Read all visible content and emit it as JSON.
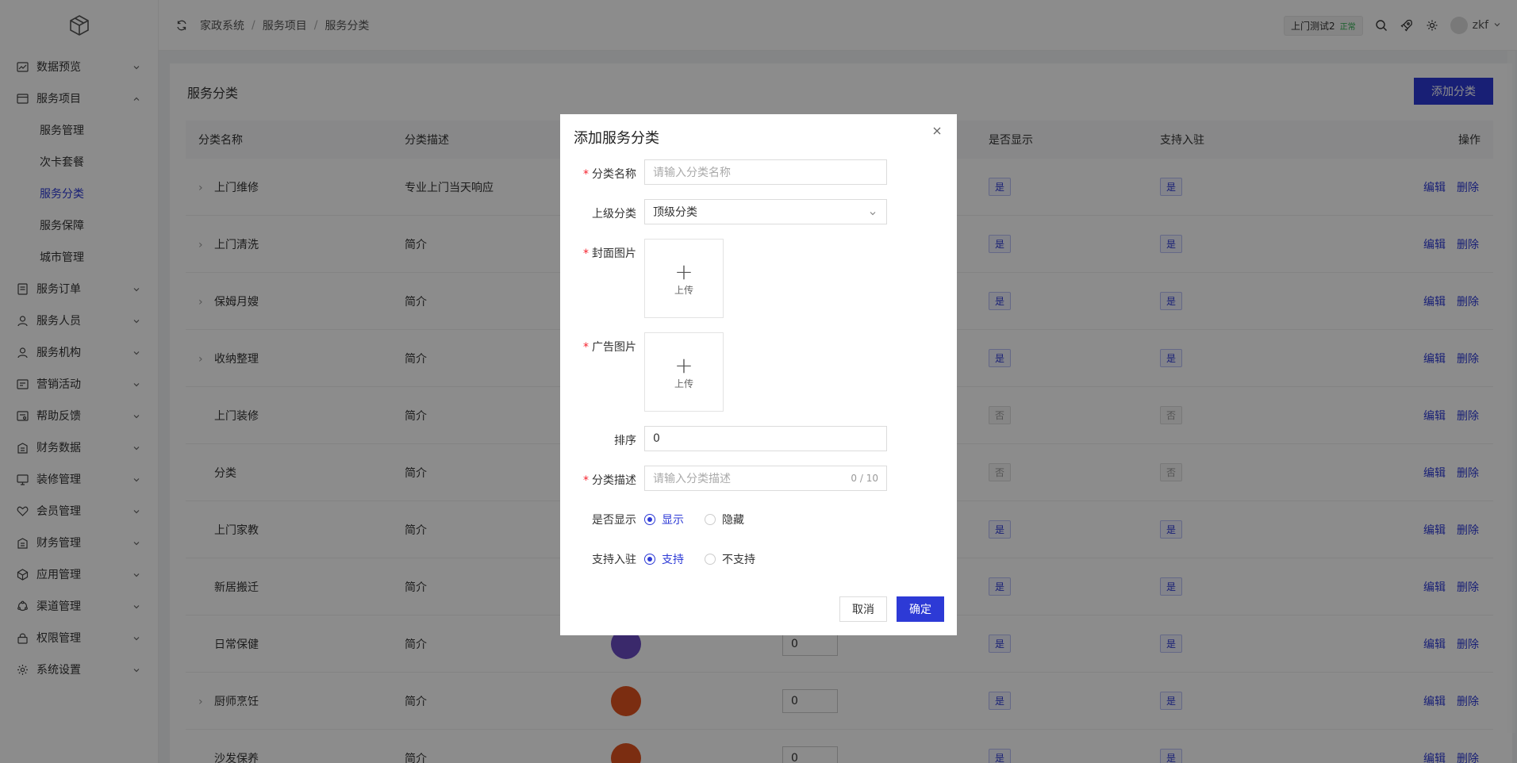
{
  "sidebar": {
    "items": [
      {
        "label": "数据预览"
      },
      {
        "label": "服务项目"
      },
      {
        "label": "服务订单"
      },
      {
        "label": "服务人员"
      },
      {
        "label": "服务机构"
      },
      {
        "label": "营销活动"
      },
      {
        "label": "帮助反馈"
      },
      {
        "label": "财务数据"
      },
      {
        "label": "装修管理"
      },
      {
        "label": "会员管理"
      },
      {
        "label": "财务管理"
      },
      {
        "label": "应用管理"
      },
      {
        "label": "渠道管理"
      },
      {
        "label": "权限管理"
      },
      {
        "label": "系统设置"
      }
    ],
    "sub_items": [
      {
        "label": "服务管理"
      },
      {
        "label": "次卡套餐"
      },
      {
        "label": "服务分类"
      },
      {
        "label": "服务保障"
      },
      {
        "label": "城市管理"
      }
    ]
  },
  "header": {
    "breadcrumb": [
      "家政系统",
      "服务项目",
      "服务分类"
    ],
    "store_name": "上门测试2",
    "store_status": "正常",
    "username": "zkf"
  },
  "main": {
    "title": "服务分类",
    "add_button": "添加分类",
    "columns": [
      "分类名称",
      "分类描述",
      "是否显示",
      "支持入驻",
      "操作"
    ],
    "rows": [
      {
        "name": "上门维修",
        "desc": "专业上门当天响应",
        "show": "是",
        "join": "是"
      },
      {
        "name": "上门清洗",
        "desc": "简介",
        "show": "是",
        "join": "是"
      },
      {
        "name": "保姆月嫂",
        "desc": "简介",
        "show": "是",
        "join": "是"
      },
      {
        "name": "收纳整理",
        "desc": "简介",
        "show": "是",
        "join": "是"
      },
      {
        "name": "上门装修",
        "desc": "简介",
        "show": "否",
        "join": "否"
      },
      {
        "name": "分类",
        "desc": "简介",
        "show": "否",
        "join": "否"
      },
      {
        "name": "上门家教",
        "desc": "简介",
        "show": "是",
        "join": "是"
      },
      {
        "name": "新居搬迁",
        "desc": "简介",
        "show": "是",
        "join": "是"
      },
      {
        "name": "日常保健",
        "desc": "简介",
        "sort": "0",
        "show": "是",
        "join": "是"
      },
      {
        "name": "厨师烹饪",
        "desc": "简介",
        "sort": "0",
        "show": "是",
        "join": "是"
      },
      {
        "name": "沙发保养",
        "desc": "简介",
        "sort": "0",
        "show": "是",
        "join": "是"
      }
    ],
    "edit_label": "编辑",
    "delete_label": "删除"
  },
  "dialog": {
    "title": "添加服务分类",
    "name_label": "分类名称",
    "name_placeholder": "请输入分类名称",
    "parent_label": "上级分类",
    "parent_value": "顶级分类",
    "cover_label": "封面图片",
    "ad_label": "广告图片",
    "upload_text": "上传",
    "sort_label": "排序",
    "sort_value": "0",
    "desc_label": "分类描述",
    "desc_placeholder": "请输入分类描述",
    "desc_count": "0 / 10",
    "show_label": "是否显示",
    "show_on": "显示",
    "show_off": "隐藏",
    "join_label": "支持入驻",
    "join_on": "支持",
    "join_off": "不支持",
    "cancel": "取消",
    "ok": "确定"
  },
  "colors": {
    "primary": "#2d3ad6",
    "required": "#f5222d",
    "status_ok": "#2eae4f"
  }
}
